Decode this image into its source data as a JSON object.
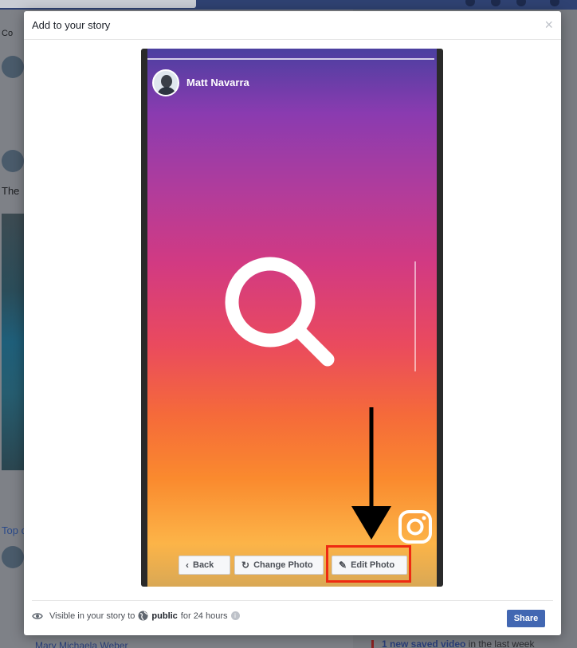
{
  "modal": {
    "title": "Add to your story",
    "close_label": "×"
  },
  "story": {
    "author": "Matt Navarra",
    "buttons": {
      "back": "Back",
      "change_photo": "Change Photo",
      "edit_photo": "Edit Photo"
    }
  },
  "footer": {
    "visible_prefix": "Visible in your story to",
    "audience": "public",
    "duration": "for 24 hours",
    "share_label": "Share"
  },
  "background": {
    "composer_label": "Co",
    "post_text_fragment": "The",
    "top_comments_fragment": "Top c",
    "commenter_name": "Mary Michaela Weber",
    "saved_video_link": "1 new saved video",
    "saved_video_suffix": "in the last week"
  },
  "colors": {
    "share_button": "#4267b2",
    "highlight_box": "#ee2a12",
    "topbar": "#2f4272"
  }
}
